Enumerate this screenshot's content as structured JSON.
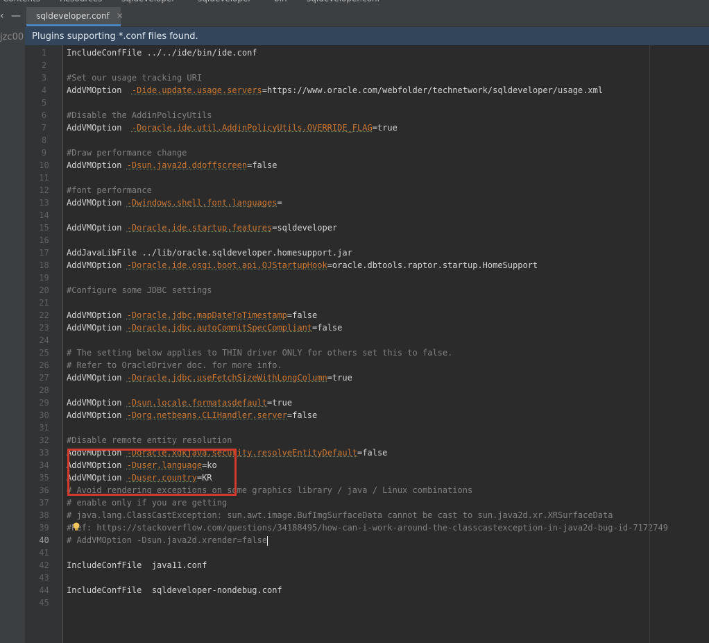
{
  "breadcrumb": [
    "Contents",
    "Resources",
    "sqldeveloper",
    "sqldeveloper",
    "bin",
    "sqldeveloper.conf"
  ],
  "sidebar": {
    "project_label": "jzc00"
  },
  "tab": {
    "label": "sqldeveloper.conf",
    "close": "✕"
  },
  "notice": {
    "text": "Plugins supporting *.conf files found."
  },
  "editor": {
    "current_line": 40,
    "lines": [
      {
        "n": 1,
        "parts": [
          [
            "kw",
            "IncludeConfFile ../../ide/bin/ide.conf"
          ]
        ]
      },
      {
        "n": 2,
        "parts": []
      },
      {
        "n": 3,
        "parts": [
          [
            "cm",
            "#Set our usage tracking URI"
          ]
        ]
      },
      {
        "n": 4,
        "parts": [
          [
            "kw",
            "AddVMOption  "
          ],
          [
            "key",
            "-Dide.update.usage.servers"
          ],
          [
            "val",
            "=https://www.oracle.com/webfolder/technetwork/sqldeveloper/usage.xml"
          ]
        ]
      },
      {
        "n": 5,
        "parts": []
      },
      {
        "n": 6,
        "parts": [
          [
            "cm",
            "#Disable the AddinPolicyUtils"
          ]
        ]
      },
      {
        "n": 7,
        "parts": [
          [
            "kw",
            "AddVMOption  "
          ],
          [
            "key",
            "-Doracle.ide.util.AddinPolicyUtils.OVERRIDE_FLAG"
          ],
          [
            "val",
            "=true"
          ]
        ]
      },
      {
        "n": 8,
        "parts": []
      },
      {
        "n": 9,
        "parts": [
          [
            "cm",
            "#Draw performance change"
          ]
        ]
      },
      {
        "n": 10,
        "parts": [
          [
            "kw",
            "AddVMOption "
          ],
          [
            "key",
            "-Dsun.java2d.ddoffscreen"
          ],
          [
            "val",
            "=false"
          ]
        ]
      },
      {
        "n": 11,
        "parts": []
      },
      {
        "n": 12,
        "parts": [
          [
            "cm",
            "#font performance"
          ]
        ]
      },
      {
        "n": 13,
        "parts": [
          [
            "kw",
            "AddVMOption "
          ],
          [
            "key",
            "-Dwindows.shell.font.languages"
          ],
          [
            "val",
            "="
          ]
        ]
      },
      {
        "n": 14,
        "parts": []
      },
      {
        "n": 15,
        "parts": [
          [
            "kw",
            "AddVMOption "
          ],
          [
            "key",
            "-Doracle.ide.startup.features"
          ],
          [
            "val",
            "=sqldeveloper"
          ]
        ]
      },
      {
        "n": 16,
        "parts": []
      },
      {
        "n": 17,
        "parts": [
          [
            "kw",
            "AddJavaLibFile ../lib/oracle.sqldeveloper.homesupport.jar"
          ]
        ]
      },
      {
        "n": 18,
        "parts": [
          [
            "kw",
            "AddVMOption "
          ],
          [
            "key",
            "-Doracle.ide.osgi.boot.api.OJStartupHook"
          ],
          [
            "val",
            "=oracle.dbtools.raptor.startup.HomeSupport"
          ]
        ]
      },
      {
        "n": 19,
        "parts": []
      },
      {
        "n": 20,
        "parts": [
          [
            "cm",
            "#Configure some JDBC settings"
          ]
        ]
      },
      {
        "n": 21,
        "parts": []
      },
      {
        "n": 22,
        "parts": [
          [
            "kw",
            "AddVMOption "
          ],
          [
            "key",
            "-Doracle.jdbc.mapDateToTimestamp"
          ],
          [
            "val",
            "=false"
          ]
        ]
      },
      {
        "n": 23,
        "parts": [
          [
            "kw",
            "AddVMOption "
          ],
          [
            "key",
            "-Doracle.jdbc.autoCommitSpecCompliant"
          ],
          [
            "val",
            "=false"
          ]
        ]
      },
      {
        "n": 24,
        "parts": []
      },
      {
        "n": 25,
        "parts": [
          [
            "cm",
            "# The setting below applies to THIN driver ONLY for others set this to false."
          ]
        ]
      },
      {
        "n": 26,
        "parts": [
          [
            "cm",
            "# Refer to OracleDriver doc. for more info."
          ]
        ]
      },
      {
        "n": 27,
        "parts": [
          [
            "kw",
            "AddVMOption "
          ],
          [
            "key",
            "-Doracle.jdbc.useFetchSizeWithLongColumn"
          ],
          [
            "val",
            "=true"
          ]
        ]
      },
      {
        "n": 28,
        "parts": []
      },
      {
        "n": 29,
        "parts": [
          [
            "kw",
            "AddVMOption "
          ],
          [
            "key",
            "-Dsun.locale.formatasdefault"
          ],
          [
            "val",
            "=true"
          ]
        ]
      },
      {
        "n": 30,
        "parts": [
          [
            "kw",
            "AddVMOption "
          ],
          [
            "key",
            "-Dorg.netbeans.CLIHandler.server"
          ],
          [
            "val",
            "=false"
          ]
        ]
      },
      {
        "n": 31,
        "parts": []
      },
      {
        "n": 32,
        "parts": [
          [
            "cm",
            "#Disable remote entity resolution"
          ]
        ]
      },
      {
        "n": 33,
        "parts": [
          [
            "kw",
            "AddVMOption "
          ],
          [
            "key",
            "-Doracle.xdkjava.security.resolveEntityDefault"
          ],
          [
            "val",
            "=false"
          ]
        ]
      },
      {
        "n": 34,
        "parts": [
          [
            "kw",
            "AddVMOption "
          ],
          [
            "key",
            "-Duser.language"
          ],
          [
            "val",
            "=ko"
          ]
        ]
      },
      {
        "n": 35,
        "parts": [
          [
            "kw",
            "AddVMOption "
          ],
          [
            "key",
            "-Duser.country"
          ],
          [
            "val",
            "=KR"
          ]
        ]
      },
      {
        "n": 36,
        "parts": [
          [
            "cm",
            "# Avoid rendering exceptions on some graphics library / java / Linux combinations"
          ]
        ]
      },
      {
        "n": 37,
        "parts": [
          [
            "cm",
            "# enable only if you are getting"
          ]
        ]
      },
      {
        "n": 38,
        "parts": [
          [
            "cm",
            "# java.lang.ClassCastException: sun.awt.image.BufImgSurfaceData cannot be cast to sun.java2d.xr.XRSurfaceData"
          ]
        ]
      },
      {
        "n": 39,
        "parts": [
          [
            "cm",
            "#Ref: https://stackoverflow.com/questions/34188495/how-can-i-work-around-the-classcastexception-in-java2d-bug-id-7172749"
          ]
        ]
      },
      {
        "n": 40,
        "parts": [
          [
            "cm",
            "# AddVMOption -Dsun.java2d.xrender=false"
          ]
        ]
      },
      {
        "n": 41,
        "parts": []
      },
      {
        "n": 42,
        "parts": [
          [
            "kw",
            "IncludeConfFile  java11.conf"
          ]
        ]
      },
      {
        "n": 43,
        "parts": []
      },
      {
        "n": 44,
        "parts": [
          [
            "kw",
            "IncludeConfFile  sqldeveloper-nondebug.conf"
          ]
        ]
      },
      {
        "n": 45,
        "parts": []
      }
    ]
  },
  "colors": {
    "accent_tab": "#4a88c7",
    "highlight_box": "#d33a2c",
    "comment": "#808080",
    "option_key": "#cc7832"
  }
}
